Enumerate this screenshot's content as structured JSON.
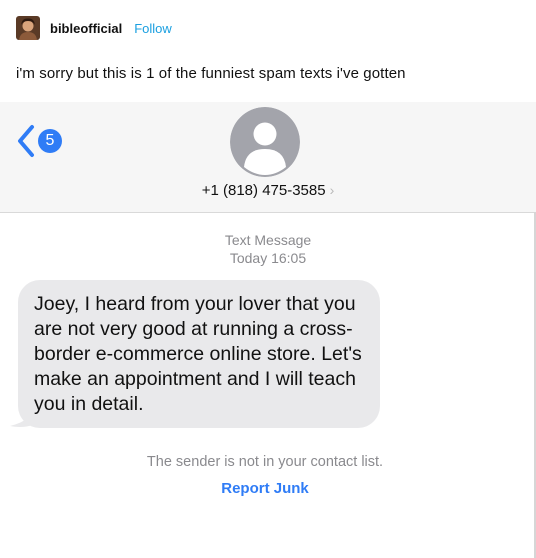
{
  "post": {
    "username": "bibleofficial",
    "follow_label": "Follow",
    "caption": "i'm sorry but this is 1 of the funniest spam texts i've gotten"
  },
  "messages_screen": {
    "back_badge_count": "5",
    "contact_number": "+1 (818) 475-3585",
    "contact_chevron": "›",
    "message_type": "Text Message",
    "message_time": "Today 16:05",
    "message_body": "Joey, I heard from your lover that you are not very good at running a cross-border e-commerce online store. Let's make an appointment and I will teach you in detail.",
    "sender_note": "The sender is not in your contact list.",
    "report_junk_label": "Report Junk"
  },
  "icons": {
    "back": "chevron-left-icon",
    "contact": "person-silhouette-icon",
    "avatar": "user-avatar"
  },
  "colors": {
    "accent_blue": "#2f7cf6",
    "follow_blue": "#1a9fe0",
    "bubble_gray": "#e9e9eb",
    "meta_gray": "#8a8a8e",
    "header_bg": "#f6f6f6"
  }
}
